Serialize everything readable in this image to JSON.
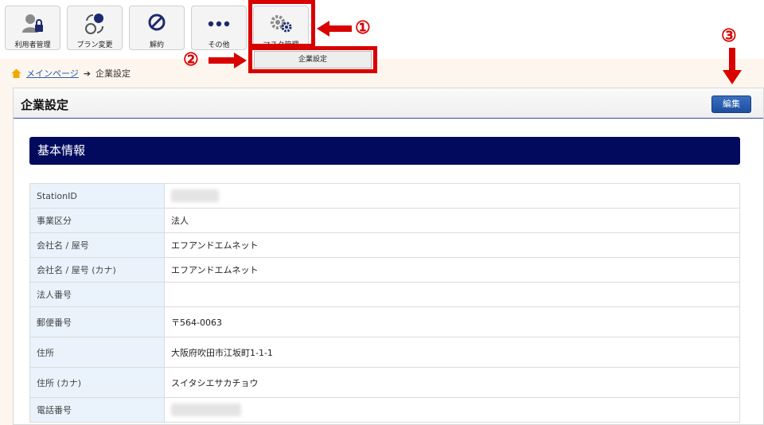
{
  "toolbar": {
    "items": [
      {
        "label": "利用者管理",
        "icon": "user-lock-icon"
      },
      {
        "label": "プラン変更",
        "icon": "plan-change-icon"
      },
      {
        "label": "解約",
        "icon": "prohibit-icon"
      },
      {
        "label": "その他",
        "icon": "more-dots-icon"
      },
      {
        "label": "マスタ管理",
        "icon": "gears-icon"
      }
    ]
  },
  "dropdown": {
    "item": "企業設定"
  },
  "annotations": {
    "n1": "①",
    "n2": "②",
    "n3": "③",
    "color": "#d90000"
  },
  "breadcrumb": {
    "home": "メインページ",
    "current": "企業設定"
  },
  "page": {
    "title": "企業設定",
    "edit_label": "編集"
  },
  "section": {
    "title": "基本情報"
  },
  "rows": [
    {
      "key": "StationID",
      "value": ""
    },
    {
      "key": "事業区分",
      "value": "法人"
    },
    {
      "key": "会社名 / 屋号",
      "value": "エフアンドエムネット"
    },
    {
      "key": "会社名 / 屋号 (カナ)",
      "value": "エフアンドエムネット"
    },
    {
      "key": "法人番号",
      "value": ""
    },
    {
      "key": "郵便番号",
      "value": "〒564-0063"
    },
    {
      "key": "住所",
      "value": "大阪府吹田市江坂町1-1-1"
    },
    {
      "key": "住所 (カナ)",
      "value": "スイタシエサカチョウ"
    },
    {
      "key": "電話番号",
      "value": ""
    }
  ],
  "colors": {
    "header_navy": "#020a5e",
    "edit_blue": "#1e4f9e",
    "key_bg": "#eaf3fb"
  }
}
